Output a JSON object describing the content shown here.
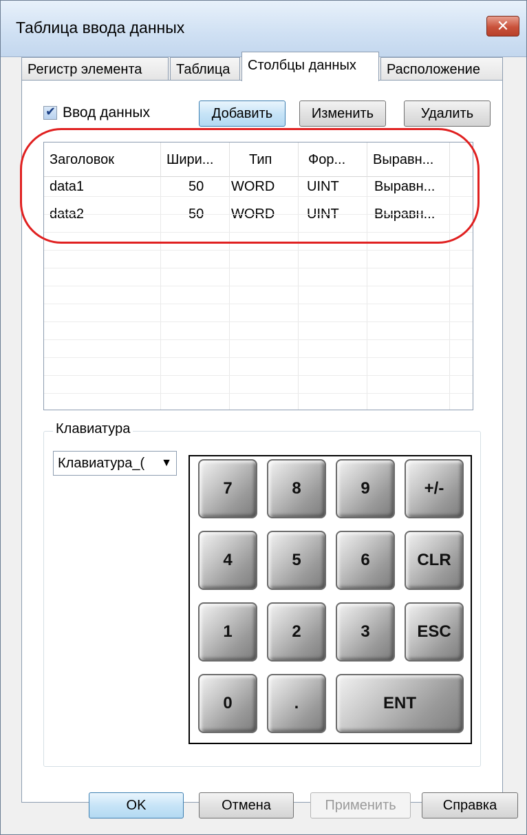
{
  "window": {
    "title": "Таблица ввода данных"
  },
  "tabs": [
    "Регистр элемента",
    "Таблица",
    "Столбцы данных",
    "Расположение"
  ],
  "active_tab": "Столбцы данных",
  "checkbox": {
    "label": "Ввод данных",
    "checked": true
  },
  "buttons": {
    "add": "Добавить",
    "edit": "Изменить",
    "delete": "Удалить"
  },
  "table": {
    "headers": [
      "Заголовок",
      "Шири...",
      "Тип",
      "Фор...",
      "Выравн..."
    ],
    "rows": [
      [
        "data1",
        "50",
        "WORD",
        "UINT",
        "Выравн..."
      ],
      [
        "data2",
        "50",
        "WORD",
        "UINT",
        "Выравн..."
      ]
    ]
  },
  "keyboard_group": {
    "title": "Клавиатура",
    "selected": "Клавиатура_("
  },
  "keypad": {
    "keys": [
      "7",
      "8",
      "9",
      "+/-",
      "4",
      "5",
      "6",
      "CLR",
      "1",
      "2",
      "3",
      "ESC",
      "0",
      ".",
      "ENT"
    ]
  },
  "footer": {
    "ok": "OK",
    "cancel": "Отмена",
    "apply": "Применить",
    "help": "Справка"
  },
  "colors": {
    "highlight": "#e02020",
    "title_bar": "#cfe0f3",
    "close_button": "#c9523b"
  }
}
